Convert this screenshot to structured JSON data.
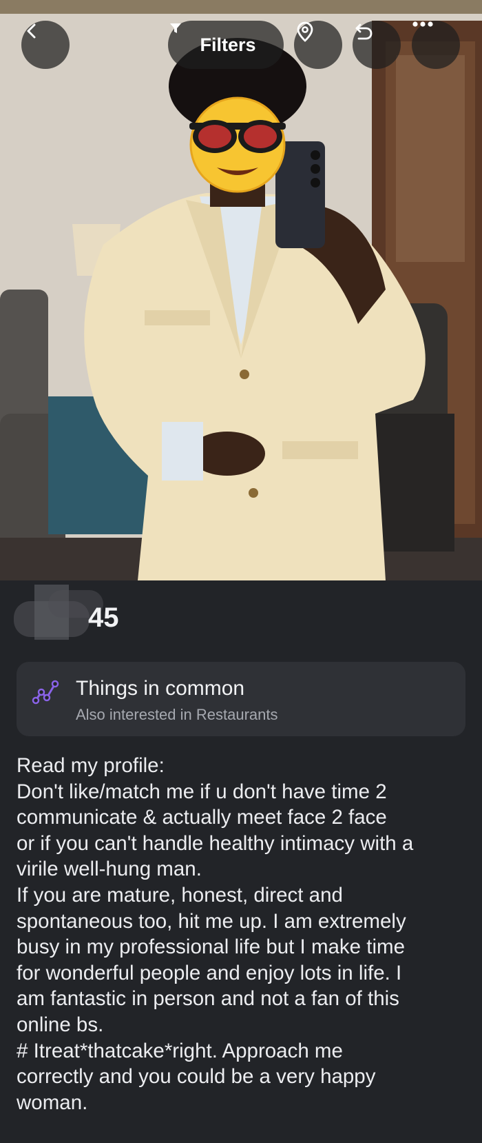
{
  "topbar": {
    "back_icon": "chevron-left-icon",
    "filters_label": "Filters",
    "filters_icon": "funnel-icon",
    "location_icon": "map-pin-icon",
    "undo_icon": "undo-arrow-icon",
    "more_icon": "ellipsis-icon"
  },
  "profile": {
    "age": "45",
    "things_in_common": {
      "icon": "interests-graph-icon",
      "title": "Things in common",
      "subtitle": "Also interested in Restaurants"
    },
    "bio_lines": [
      "Read my profile:",
      "Don't like/match me if u don't have time 2",
      "communicate & actually meet face 2 face",
      "or if you can't handle healthy intimacy with a",
      "virile well-hung man.",
      "If you are mature, honest, direct and",
      "spontaneous too, hit me up. I am extremely",
      "busy in my professional life but I make time",
      "for wonderful people and enjoy lots in life. I",
      "am fantastic in person and not a fan of this",
      "online bs.",
      "# Itreat*thatcake*right. Approach me",
      "correctly and you could be a very happy",
      "woman."
    ]
  },
  "colors": {
    "background": "#222428",
    "card": "#2f3136",
    "accent_purple": "#8a63e8",
    "subtext": "#a6a9b0"
  }
}
